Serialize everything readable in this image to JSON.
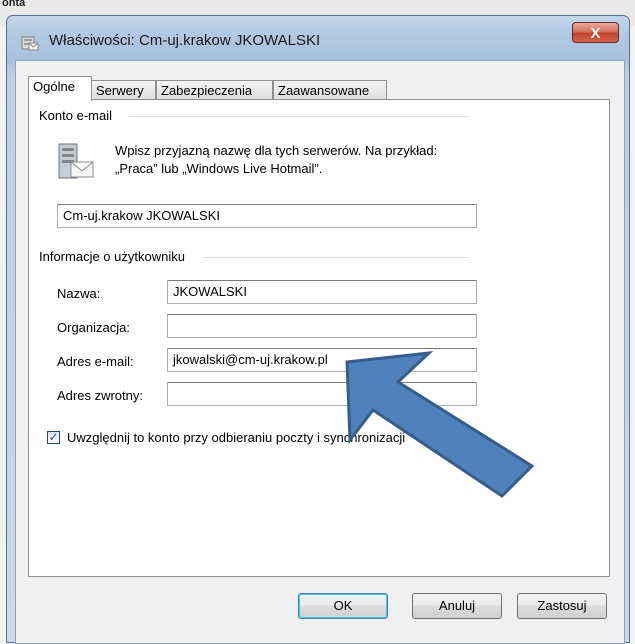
{
  "background": {
    "text": "onta"
  },
  "window": {
    "title": "Właściwości: Cm-uj.krakow JKOWALSKI",
    "close_label": "X"
  },
  "tabs": [
    {
      "label": "Ogólne",
      "active": true
    },
    {
      "label": "Serwery",
      "active": false
    },
    {
      "label": "Zabezpieczenia",
      "active": false
    },
    {
      "label": "Zaawansowane",
      "active": false
    }
  ],
  "account": {
    "group_label": "Konto e-mail",
    "hint_line1": "Wpisz przyjazną nazwę dla tych serwerów. Na przykład:",
    "hint_line2": "„Praca” lub „Windows Live Hotmail”.",
    "name_value": "Cm-uj.krakow JKOWALSKI"
  },
  "user_info": {
    "group_label": "Informacje o użytkowniku",
    "name_label": "Nazwa:",
    "name_value": "JKOWALSKI",
    "org_label": "Organizacja:",
    "org_value": "",
    "email_label": "Adres e-mail:",
    "email_value": "jkowalski@cm-uj.krakow.pl",
    "reply_label": "Adres zwrotny:",
    "reply_value": ""
  },
  "checkbox": {
    "label": "Uwzględnij to konto przy odbieraniu poczty i synchronizacji",
    "checked": true,
    "check_glyph": "✓"
  },
  "buttons": {
    "ok": "OK",
    "cancel": "Anuluj",
    "apply": "Zastosuj"
  },
  "colors": {
    "arrow_fill": "#4f81bd",
    "arrow_stroke": "#385d8a"
  }
}
